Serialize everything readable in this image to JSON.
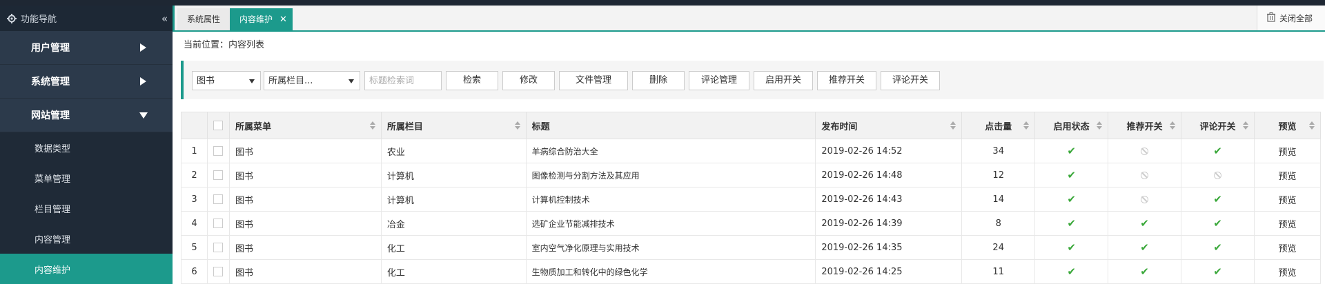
{
  "sidebar": {
    "header": "功能导航",
    "collapse_icon": "«",
    "groups": [
      {
        "label": "用户管理",
        "state": "collapsed"
      },
      {
        "label": "系统管理",
        "state": "collapsed"
      },
      {
        "label": "网站管理",
        "state": "expanded"
      }
    ],
    "subitems": [
      "数据类型",
      "菜单管理",
      "栏目管理",
      "内容管理",
      "内容维护"
    ],
    "active_subitem": "内容维护"
  },
  "tabs": [
    {
      "label": "系统属性",
      "active": false
    },
    {
      "label": "内容维护",
      "active": true,
      "close": "✕"
    }
  ],
  "close_all": "关闭全部",
  "breadcrumb": "当前位置：内容列表",
  "toolbar": {
    "category_select": "图书",
    "column_select": "所属栏目...",
    "search_placeholder": "标题检索词",
    "buttons": [
      "检索",
      "修改",
      "文件管理",
      "删除",
      "评论管理",
      "启用开关",
      "推荐开关",
      "评论开关"
    ]
  },
  "table": {
    "headers": [
      "所属菜单",
      "所属栏目",
      "标题",
      "发布时间",
      "点击量",
      "启用状态",
      "推荐开关",
      "评论开关",
      "预览"
    ],
    "rows": [
      {
        "no": "1",
        "menu": "图书",
        "column": "农业",
        "title": "羊病综合防治大全",
        "time": "2019-02-26 14:52",
        "clicks": "34",
        "enabled": true,
        "recommend": false,
        "comment": true,
        "preview": "预览"
      },
      {
        "no": "2",
        "menu": "图书",
        "column": "计算机",
        "title": "图像检测与分割方法及其应用",
        "time": "2019-02-26 14:48",
        "clicks": "12",
        "enabled": true,
        "recommend": false,
        "comment": false,
        "preview": "预览"
      },
      {
        "no": "3",
        "menu": "图书",
        "column": "计算机",
        "title": "计算机控制技术",
        "time": "2019-02-26 14:43",
        "clicks": "14",
        "enabled": true,
        "recommend": false,
        "comment": true,
        "preview": "预览"
      },
      {
        "no": "4",
        "menu": "图书",
        "column": "冶金",
        "title": "选矿企业节能减排技术",
        "time": "2019-02-26 14:39",
        "clicks": "8",
        "enabled": true,
        "recommend": true,
        "comment": true,
        "preview": "预览"
      },
      {
        "no": "5",
        "menu": "图书",
        "column": "化工",
        "title": "室内空气净化原理与实用技术",
        "time": "2019-02-26 14:35",
        "clicks": "24",
        "enabled": true,
        "recommend": true,
        "comment": true,
        "preview": "预览"
      },
      {
        "no": "6",
        "menu": "图书",
        "column": "化工",
        "title": "生物质加工和转化中的绿色化学",
        "time": "2019-02-26 14:25",
        "clicks": "11",
        "enabled": true,
        "recommend": true,
        "comment": true,
        "preview": "预览"
      }
    ]
  },
  "colors": {
    "accent": "#1c9a8c",
    "sidebar": "#263342",
    "check": "#3aa83a"
  }
}
